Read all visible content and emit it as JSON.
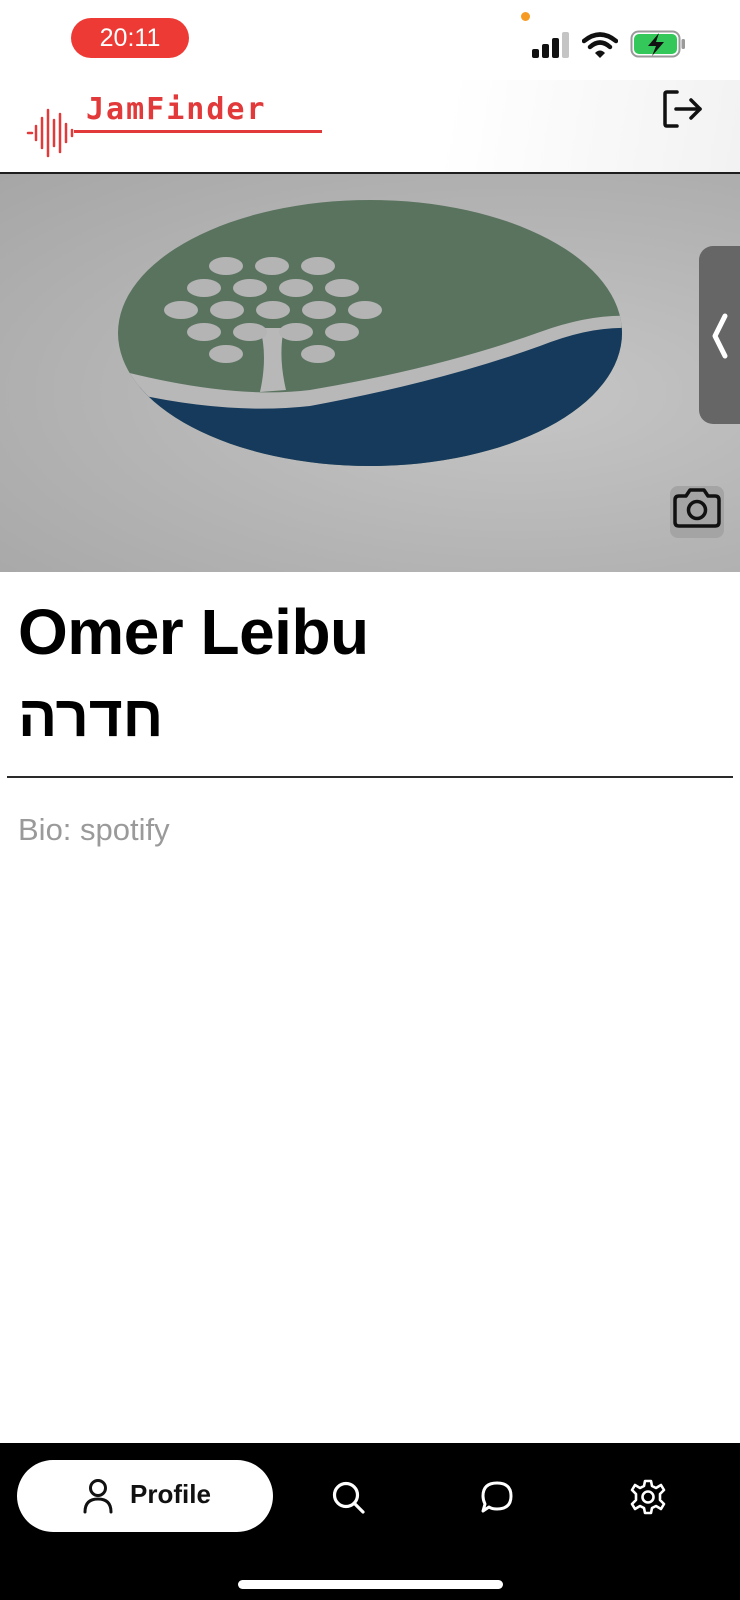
{
  "status_bar": {
    "time": "20:11",
    "recording_dot_color": "#f59a23",
    "time_pill_color": "#ee3a34",
    "battery_charging": true
  },
  "header": {
    "app_name": "JamFinder",
    "brand_color": "#e23a3a",
    "logout_icon": "logout-icon"
  },
  "cover": {
    "image": "profile-cover-logo",
    "camera_icon": "camera-icon",
    "handle_icon": "chevron-left-icon"
  },
  "profile": {
    "name": "Omer Leibu",
    "city": "חדרה",
    "bio_label": "Bio:",
    "bio_value": "spotify"
  },
  "tabs": [
    {
      "label": "Profile",
      "icon": "person-icon",
      "active": true
    },
    {
      "label": "",
      "icon": "search-icon",
      "active": false
    },
    {
      "label": "",
      "icon": "chat-icon",
      "active": false
    },
    {
      "label": "",
      "icon": "gear-icon",
      "active": false
    }
  ]
}
